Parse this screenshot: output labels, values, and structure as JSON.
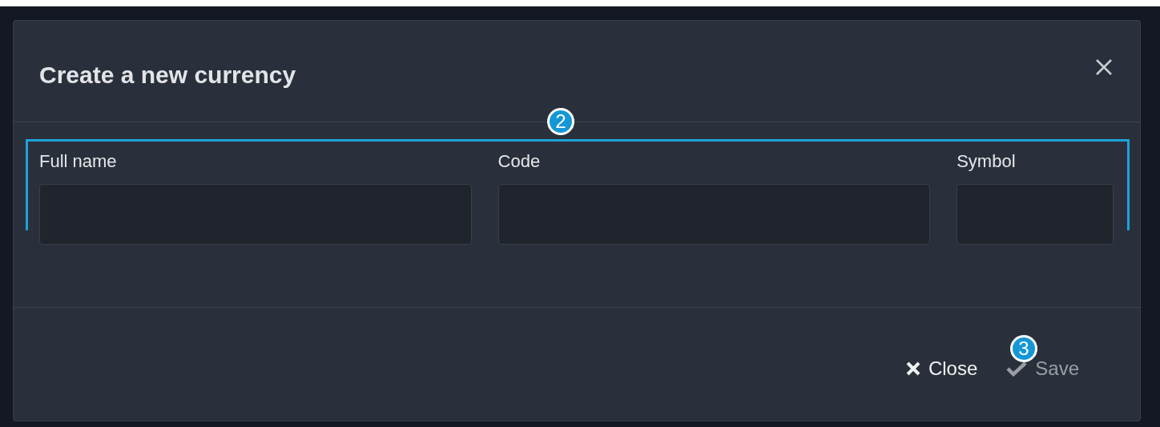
{
  "dialog": {
    "title": "Create a new currency",
    "fields": [
      {
        "label": "Full name"
      },
      {
        "label": "Code"
      },
      {
        "label": "Symbol"
      }
    ],
    "buttons": [
      {
        "kind": "close",
        "label": "Close",
        "disabled": false
      },
      {
        "kind": "save",
        "label": "Save",
        "disabled": true
      }
    ]
  },
  "callouts": [
    {
      "number": "2"
    },
    {
      "number": "3"
    }
  ]
}
